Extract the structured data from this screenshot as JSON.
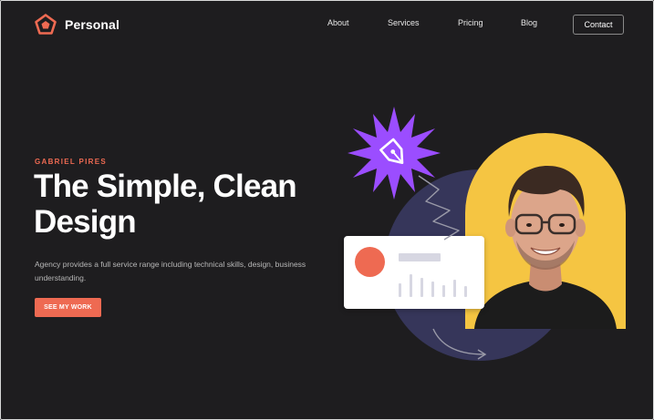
{
  "brand": {
    "name": "Personal",
    "logo_icon": "pentagon-logo-icon",
    "accent": "#ee6a52"
  },
  "nav": {
    "links": [
      "About",
      "Services",
      "Pricing",
      "Blog"
    ],
    "contact_label": "Contact"
  },
  "hero": {
    "eyebrow": "GABRIEL PIRES",
    "headline_line1": "The Simple, Clean",
    "headline_line2": "Design",
    "description_line1": "Agency provides a full service range including technical skills, design, business",
    "description_line2": "understanding.",
    "cta_label": "SEE MY WORK"
  },
  "illustration": {
    "badge_icon": "pen-nib-icon",
    "badge_color": "#9b4dff",
    "circle_color": "#36365a",
    "photo_bg": "#f5c542"
  }
}
